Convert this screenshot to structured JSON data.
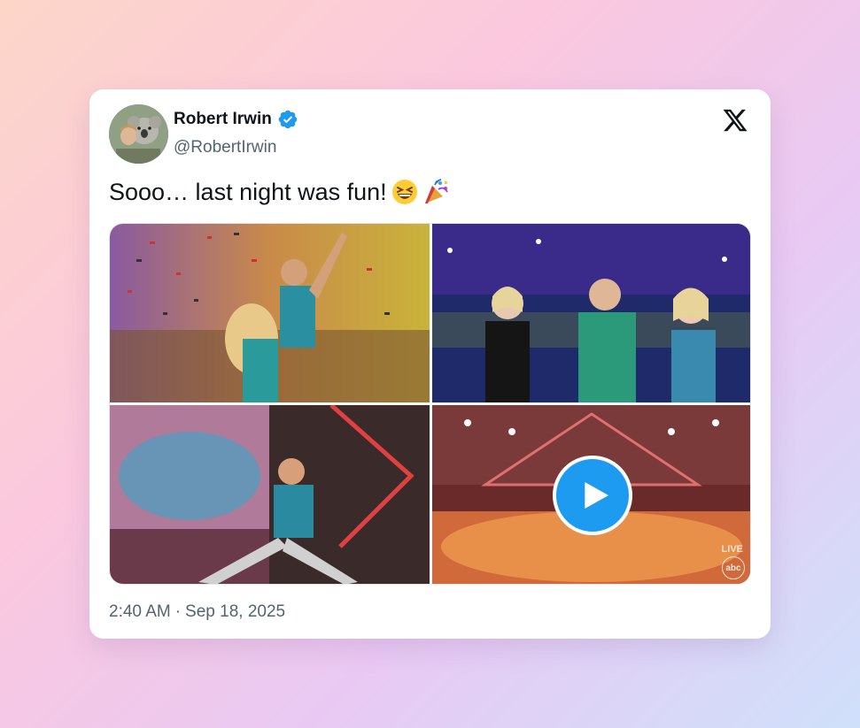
{
  "tweet": {
    "author_name": "Robert Irwin",
    "author_handle": "@RobertIrwin",
    "verified": true,
    "text": "Sooo… last night was fun!",
    "emojis": [
      "grinning-squinting-face",
      "party-popper"
    ],
    "time": "2:40 AM",
    "separator": "·",
    "date": "Sep 18, 2025"
  },
  "media": {
    "tiles": [
      {
        "description_icon": "photo"
      },
      {
        "description_icon": "photo"
      },
      {
        "description_icon": "photo"
      },
      {
        "description_icon": "video"
      }
    ],
    "video_badges": {
      "live": "LIVE",
      "network": "abc"
    }
  },
  "icons": [
    "avatar",
    "verified-badge-icon",
    "x-logo-icon",
    "play-icon"
  ],
  "colors": {
    "accent_blue": "#1d9bf0",
    "text_primary": "#0f1419",
    "text_secondary": "#536471"
  }
}
